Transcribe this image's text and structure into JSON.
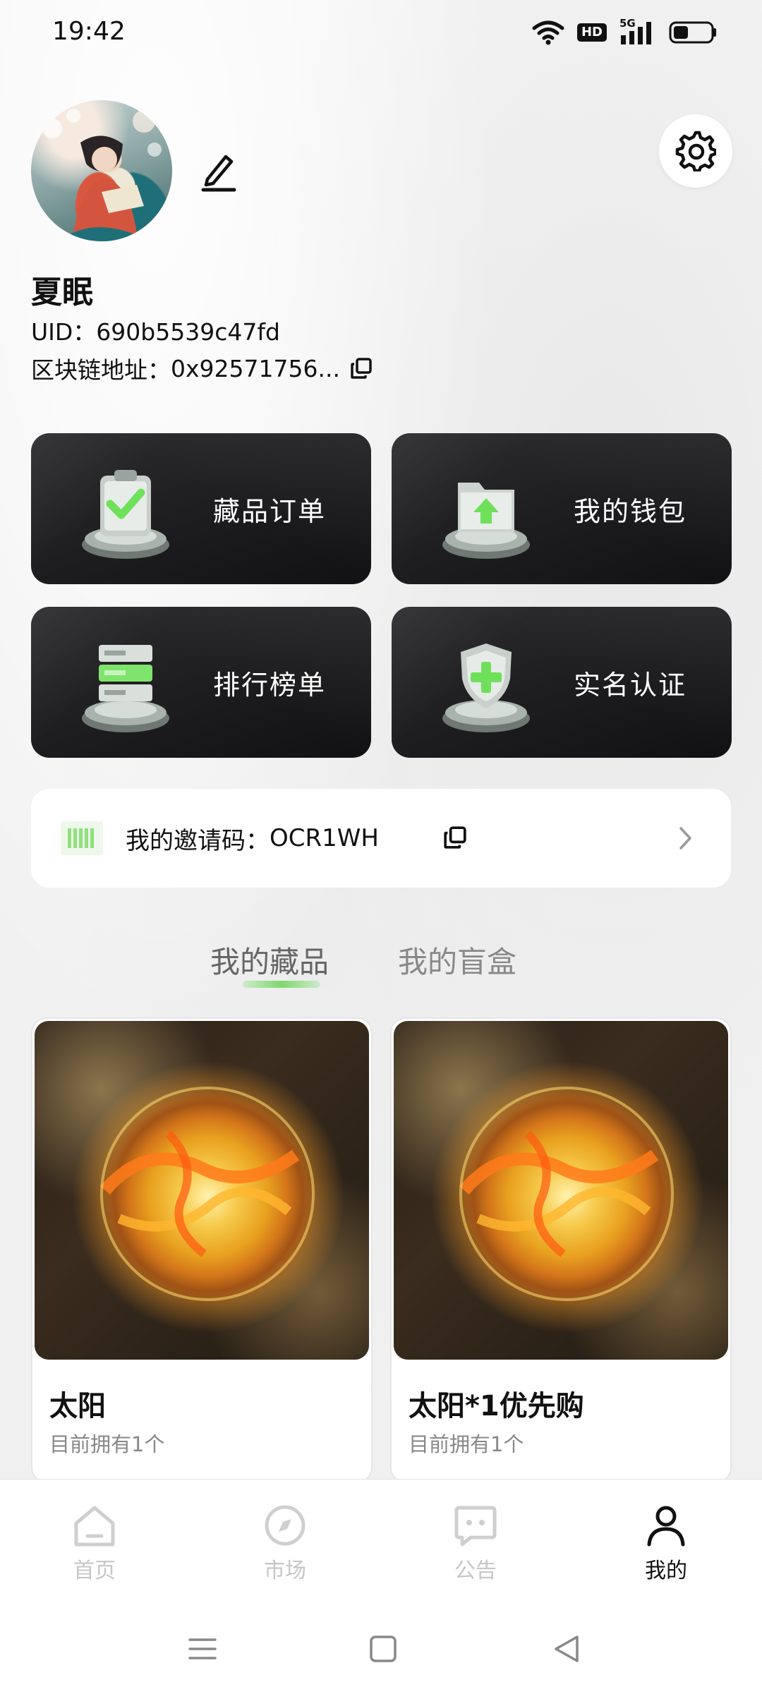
{
  "status_bar": {
    "time": "19:42",
    "icons": [
      "wifi-icon",
      "hd-icon",
      "signal-5g-icon",
      "battery-icon"
    ],
    "hd_label": "HD",
    "net_label": "5G"
  },
  "profile": {
    "name": "夏眠",
    "uid_label": "UID：",
    "uid": "690b5539c47fd",
    "chain_label": "区块链地址：",
    "chain_address": "0x92571756..."
  },
  "features": [
    {
      "label": "藏品订单",
      "icon": "order-check-icon"
    },
    {
      "label": "我的钱包",
      "icon": "wallet-folder-icon"
    },
    {
      "label": "排行榜单",
      "icon": "ranking-server-icon"
    },
    {
      "label": "实名认证",
      "icon": "shield-plus-icon"
    }
  ],
  "invite": {
    "label": "我的邀请码：",
    "code": "OCR1WH"
  },
  "tabs": [
    {
      "label": "我的藏品",
      "active": true
    },
    {
      "label": "我的盲盒",
      "active": false
    }
  ],
  "products": [
    {
      "title": "太阳",
      "subtitle": "目前拥有1个"
    },
    {
      "title": "太阳*1优先购",
      "subtitle": "目前拥有1个"
    }
  ],
  "bottom_nav": [
    {
      "label": "首页",
      "icon": "home-icon",
      "active": false
    },
    {
      "label": "市场",
      "icon": "compass-icon",
      "active": false
    },
    {
      "label": "公告",
      "icon": "message-icon",
      "active": false
    },
    {
      "label": "我的",
      "icon": "user-icon",
      "active": true
    }
  ],
  "colors": {
    "accent_green": "#7dd96b",
    "card_dark": "#1b1b1d",
    "text_primary": "#111111",
    "text_muted": "#888888"
  }
}
